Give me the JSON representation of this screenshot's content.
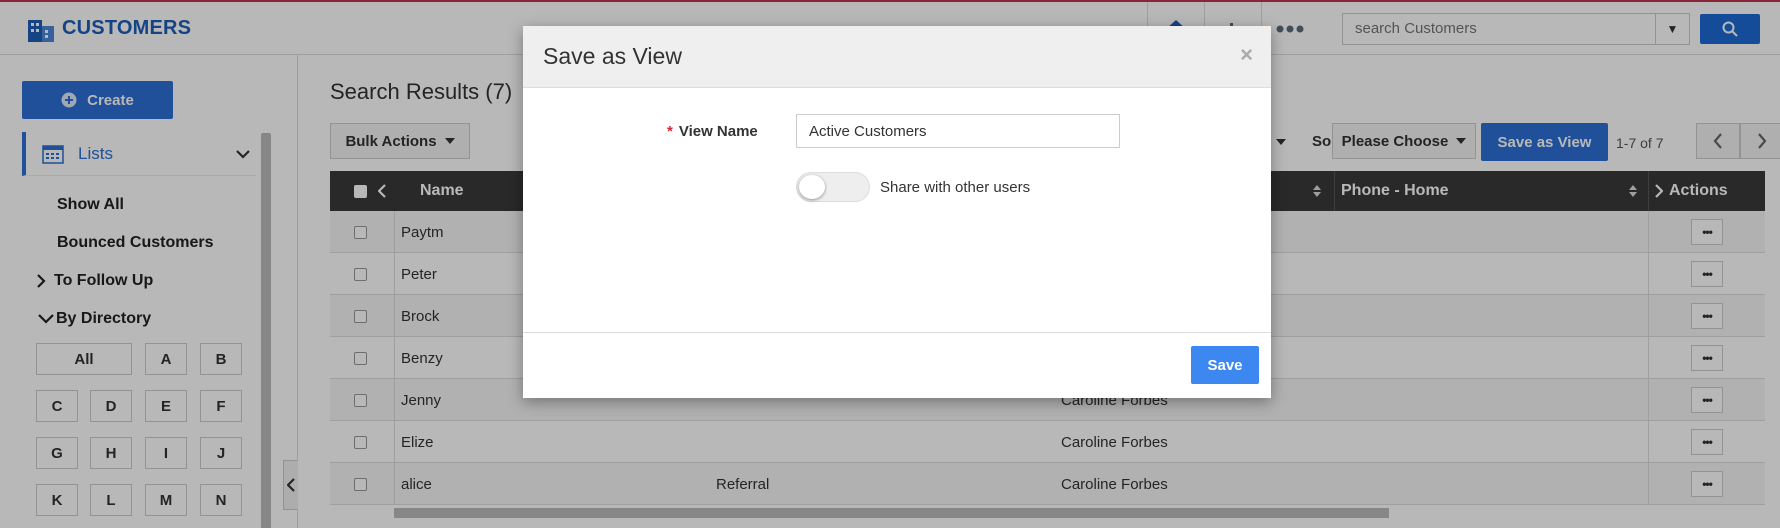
{
  "app": {
    "title": "CUSTOMERS",
    "icon": "building-icon"
  },
  "topbar": {
    "icons": [
      "home-icon",
      "chart-icon",
      "more-icon"
    ],
    "search": {
      "placeholder": "search Customers",
      "value": ""
    }
  },
  "sidebar": {
    "create_label": "Create",
    "lists_label": "Lists",
    "links": [
      "Show All",
      "Bounced Customers"
    ],
    "sections": [
      {
        "label": "To Follow Up",
        "expanded": false
      },
      {
        "label": "By Directory",
        "expanded": true
      }
    ],
    "directory": [
      "All",
      "A",
      "B",
      "C",
      "D",
      "E",
      "F",
      "G",
      "H",
      "I",
      "J",
      "K",
      "L",
      "M",
      "N"
    ]
  },
  "main": {
    "results_title": "Search Results (7)",
    "bulk_actions_label": "Bulk Actions",
    "sort_label": "Sort",
    "sort_value": "Please Choose",
    "save_as_view_label": "Save as View",
    "pagination": "1-7 of 7",
    "columns": [
      "Name",
      "Phone - Home",
      "Actions"
    ],
    "rows": [
      {
        "name": "Paytm",
        "source": "",
        "owner": ""
      },
      {
        "name": "Peter",
        "source": "",
        "owner": ""
      },
      {
        "name": "Brock",
        "source": "",
        "owner": ""
      },
      {
        "name": "Benzy",
        "source": "",
        "owner": ""
      },
      {
        "name": "Jenny",
        "source": "",
        "owner": "Caroline Forbes"
      },
      {
        "name": "Elize",
        "source": "",
        "owner": "Caroline Forbes"
      },
      {
        "name": "alice",
        "source": "Referral",
        "owner": "Caroline Forbes"
      }
    ]
  },
  "modal": {
    "title": "Save as View",
    "close": "×",
    "view_name_label": "View Name",
    "required_mark": "*",
    "view_name_value": "Active Customers",
    "share_label": "Share with other users",
    "share_enabled": false,
    "save_label": "Save"
  }
}
